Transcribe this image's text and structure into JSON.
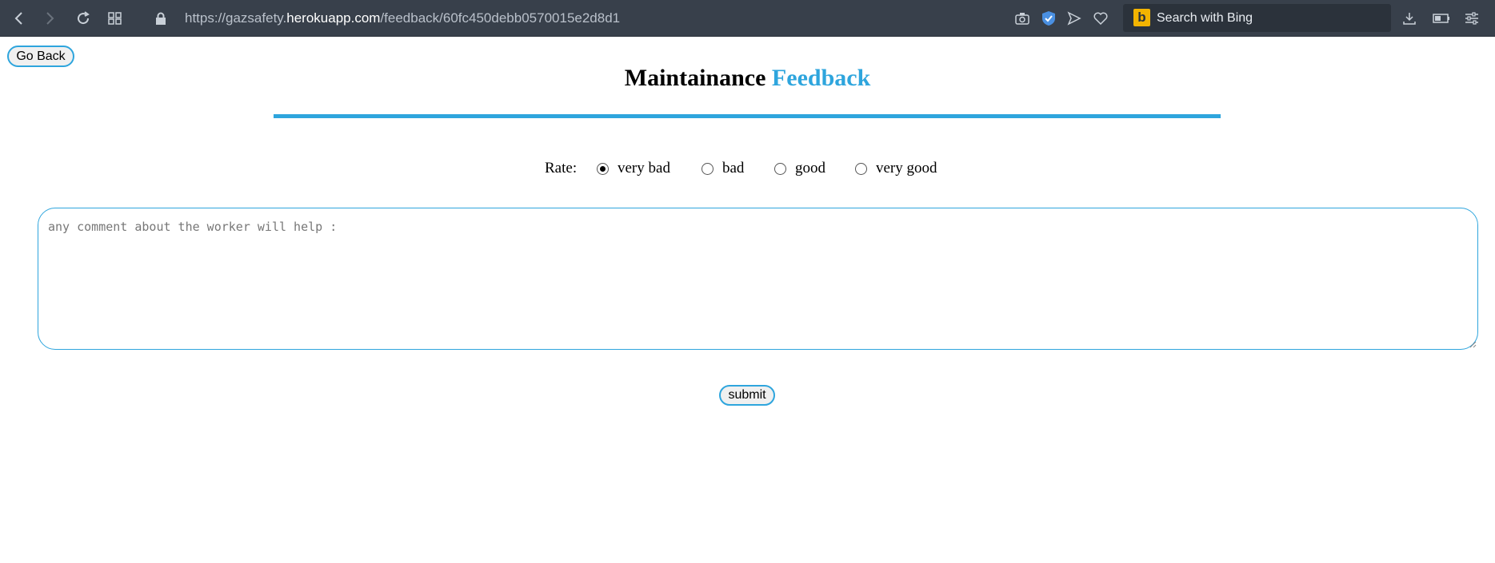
{
  "browser": {
    "url_prefix": "https://gazsafety.",
    "url_host": "herokuapp.com",
    "url_path": "/feedback/60fc450debb0570015e2d8d1",
    "search_placeholder": "Search with Bing",
    "search_logo": "b",
    "accent_color": "#2ea5dd"
  },
  "page": {
    "back_label": "Go Back",
    "title_main": "Maintainance",
    "title_accent": "Feedback",
    "rate_label": "Rate:",
    "rating_options": [
      {
        "label": "very bad",
        "checked": true
      },
      {
        "label": "bad",
        "checked": false
      },
      {
        "label": "good",
        "checked": false
      },
      {
        "label": "very good",
        "checked": false
      }
    ],
    "comment_placeholder": "any comment about the worker will help :",
    "submit_label": "submit"
  }
}
